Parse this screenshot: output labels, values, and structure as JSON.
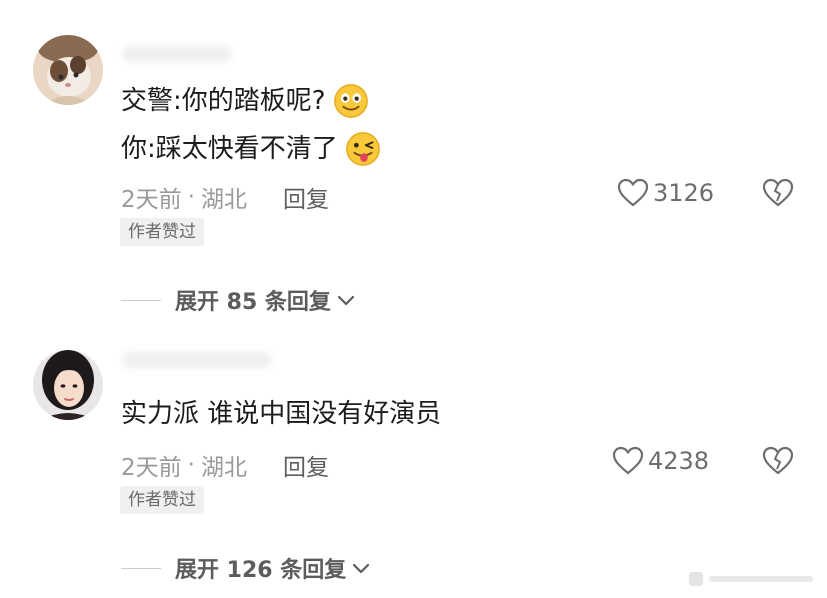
{
  "comments": [
    {
      "lines": [
        "交警:你的踏板呢?",
        "你:踩太快看不清了"
      ],
      "line_emojis": [
        "smile-emoji",
        "wink-tongue-emoji"
      ],
      "time": "2天前",
      "separator": "·",
      "location": "湖北",
      "reply_label": "回复",
      "likes": "3126",
      "badge": "作者赞过",
      "expand_label": "展开 85 条回复"
    },
    {
      "lines": [
        "实力派 谁说中国没有好演员"
      ],
      "line_emojis": [],
      "time": "2天前",
      "separator": "·",
      "location": "湖北",
      "reply_label": "回复",
      "likes": "4238",
      "badge": "作者赞过",
      "expand_label": "展开 126 条回复"
    }
  ],
  "icons": {
    "like": "heart-outline-icon",
    "dislike": "broken-heart-icon",
    "expand": "chevron-down-icon"
  },
  "colors": {
    "text": "#1c1c1c",
    "meta": "#9a9a9a",
    "badge_bg": "#f0f0f0"
  }
}
